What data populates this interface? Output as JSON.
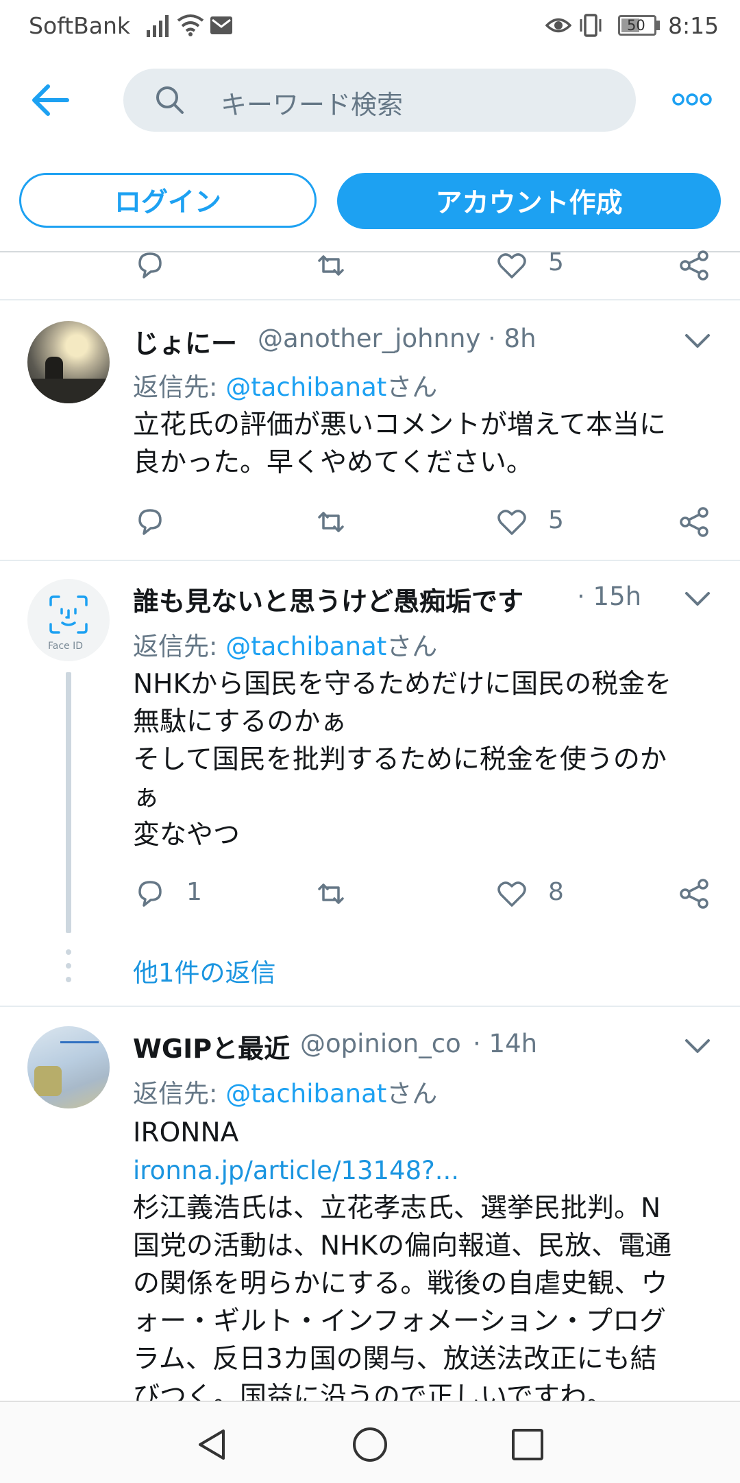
{
  "status_bar": {
    "carrier": "SoftBank",
    "battery": "50",
    "time": "8:15"
  },
  "header": {
    "search_placeholder": "キーワード検索",
    "login_label": "ログイン",
    "signup_label": "アカウント作成"
  },
  "partial_tweet": {
    "like_count": "5"
  },
  "tweets": [
    {
      "name": "じょにー",
      "handle": "@another_johnny",
      "time": "· 8h",
      "reply_prefix": "返信先: ",
      "reply_mention": "@tachibanat",
      "reply_suffix": "さん",
      "body_lines": [
        "立花氏の評価が悪いコメントが増えて本当に",
        "良かった。早くやめてください。"
      ],
      "reply_count": "",
      "like_count": "5"
    },
    {
      "name": "誰も見ないと思うけど愚痴垢です",
      "handle": "",
      "time": "· 15h",
      "avatar_label": "Face ID",
      "reply_prefix": "返信先: ",
      "reply_mention": "@tachibanat",
      "reply_suffix": "さん",
      "body_lines": [
        "NHKから国民を守るためだけに国民の税金を",
        "無駄にするのかぁ",
        "そして国民を批判するために税金を使うのか",
        "ぁ",
        "変なやつ"
      ],
      "reply_count": "1",
      "like_count": "8",
      "more_replies": "他1件の返信"
    },
    {
      "name": "WGIPと最近",
      "handle": "@opinion_co",
      "time": "· 14h",
      "reply_prefix": "返信先: ",
      "reply_mention": "@tachibanat",
      "reply_suffix": "さん",
      "body_lines": [
        "IRONNA"
      ],
      "link": "ironna.jp/article/13148?...",
      "body_lines_2": [
        "杉江義浩氏は、立花孝志氏、選挙民批判。N",
        "国党の活動は、NHKの偏向報道、民放、電通",
        "の関係を明らかにする。戦後の自虐史観、ウ",
        "ォー・ギルト・インフォメーション・プログ",
        "ラム、反日3カ国の関与、放送法改正にも結",
        "びつく。国益に沿うので正しいですわ。"
      ]
    }
  ],
  "colors": {
    "accent": "#1da1f2",
    "secondary_text": "#657786",
    "divider": "#e6ecf0"
  }
}
